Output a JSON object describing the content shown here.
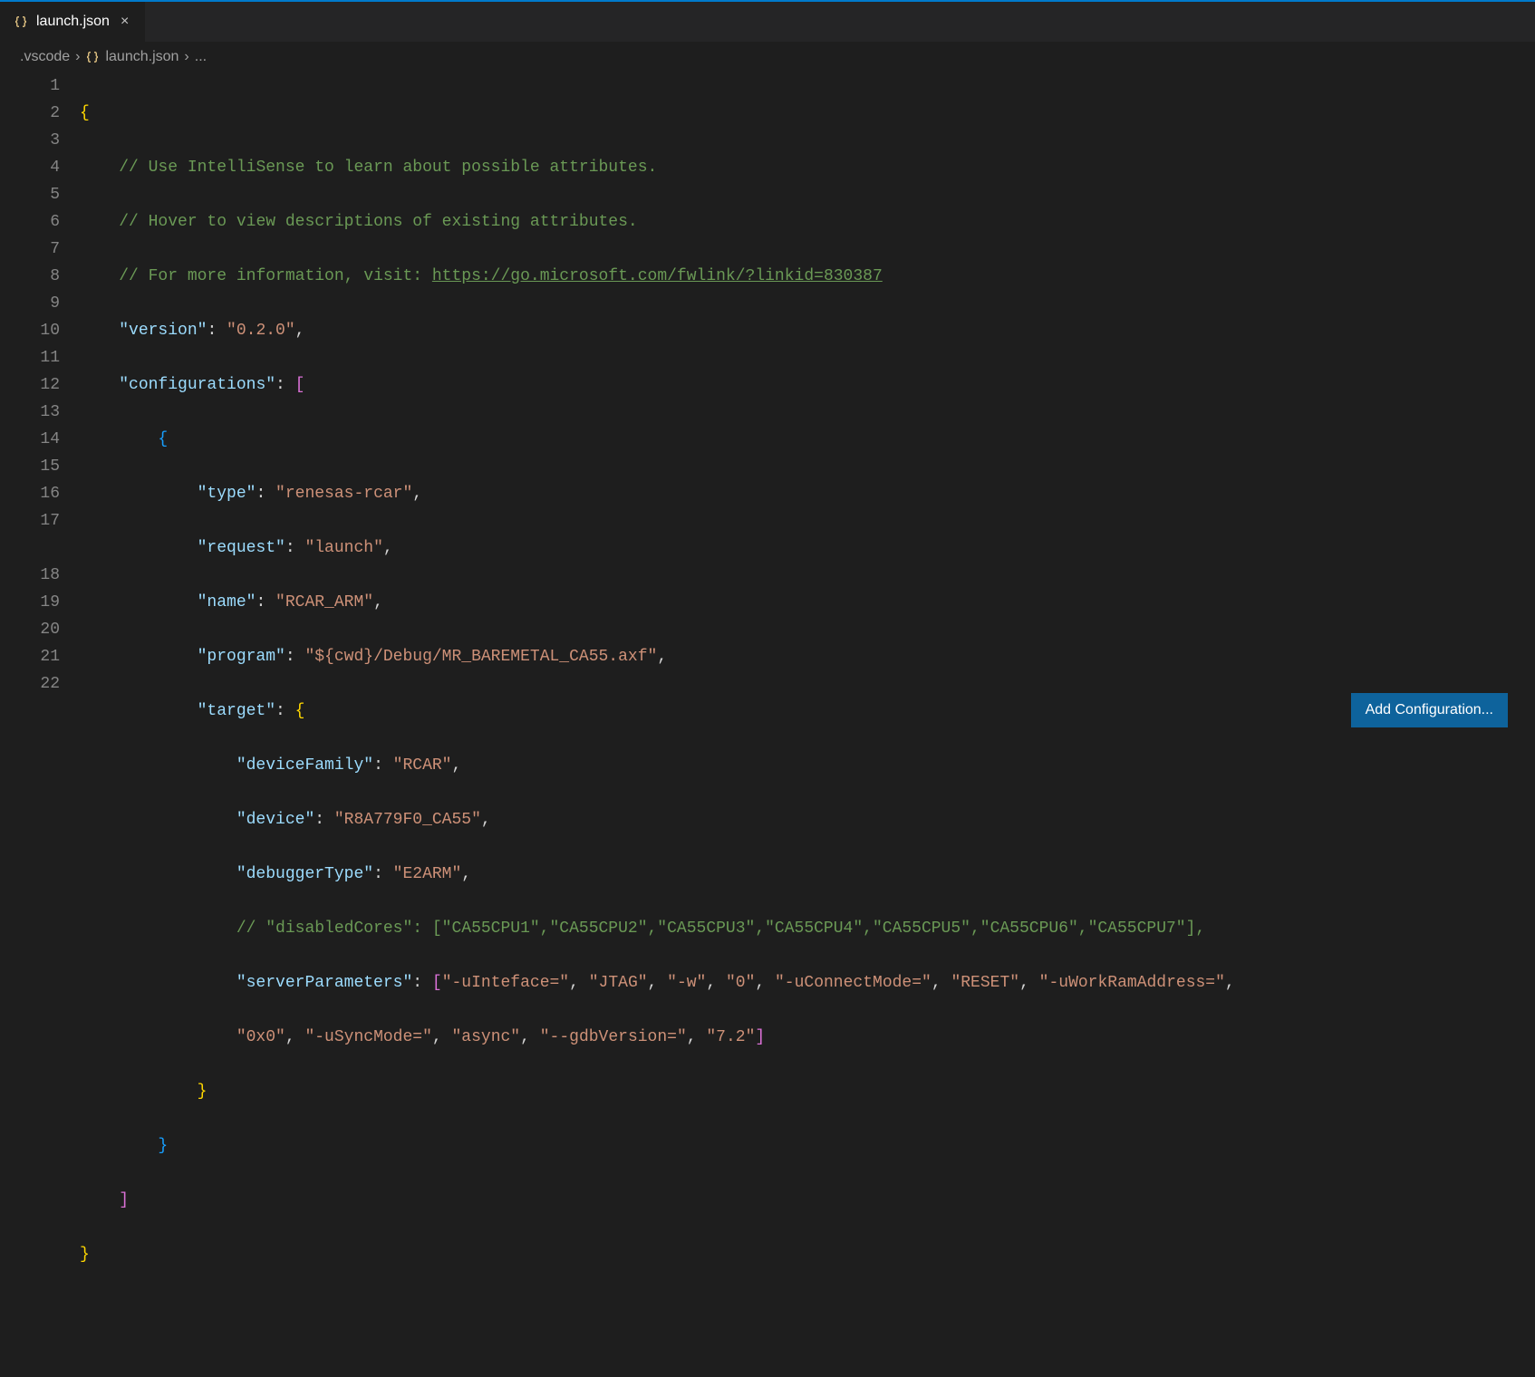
{
  "tab": {
    "filename": "launch.json",
    "close_glyph": "×"
  },
  "breadcrumb": {
    "folder": ".vscode",
    "file": "launch.json",
    "trail": "..."
  },
  "button": {
    "add_configuration": "Add Configuration..."
  },
  "line_numbers": [
    "1",
    "2",
    "3",
    "4",
    "5",
    "6",
    "7",
    "8",
    "9",
    "10",
    "11",
    "12",
    "13",
    "14",
    "15",
    "16",
    "17",
    "",
    "18",
    "19",
    "20",
    "21",
    "22"
  ],
  "code": {
    "l1": "{",
    "l2_comment": "// Use IntelliSense to learn about possible attributes.",
    "l3_comment": "// Hover to view descriptions of existing attributes.",
    "l4_comment_pre": "// For more information, visit: ",
    "l4_link": "https://go.microsoft.com/fwlink/?linkid=830387",
    "l5_key": "\"version\"",
    "l5_val": "\"0.2.0\"",
    "l6_key": "\"configurations\"",
    "l8_key": "\"type\"",
    "l8_val": "\"renesas-rcar\"",
    "l9_key": "\"request\"",
    "l9_val": "\"launch\"",
    "l10_key": "\"name\"",
    "l10_val": "\"RCAR_ARM\"",
    "l11_key": "\"program\"",
    "l11_val": "\"${cwd}/Debug/MR_BAREMETAL_CA55.axf\"",
    "l12_key": "\"target\"",
    "l13_key": "\"deviceFamily\"",
    "l13_val": "\"RCAR\"",
    "l14_key": "\"device\"",
    "l14_val": "\"R8A779F0_CA55\"",
    "l15_key": "\"debuggerType\"",
    "l15_val": "\"E2ARM\"",
    "l16_comment": "// \"disabledCores\": [\"CA55CPU1\",\"CA55CPU2\",\"CA55CPU3\",\"CA55CPU4\",\"CA55CPU5\",\"CA55CPU6\",\"CA55CPU7\"],",
    "l17_key": "\"serverParameters\"",
    "l17_v1": "\"-uInteface=\"",
    "l17_v2": "\"JTAG\"",
    "l17_v3": "\"-w\"",
    "l17_v4": "\"0\"",
    "l17_v5": "\"-uConnectMode=\"",
    "l17_v6": "\"RESET\"",
    "l17_v7": "\"-uWorkRamAddress=\"",
    "l17b_v1": "\"0x0\"",
    "l17b_v2": "\"-uSyncMode=\"",
    "l17b_v3": "\"async\"",
    "l17b_v4": "\"--gdbVersion=\"",
    "l17b_v5": "\"7.2\""
  }
}
